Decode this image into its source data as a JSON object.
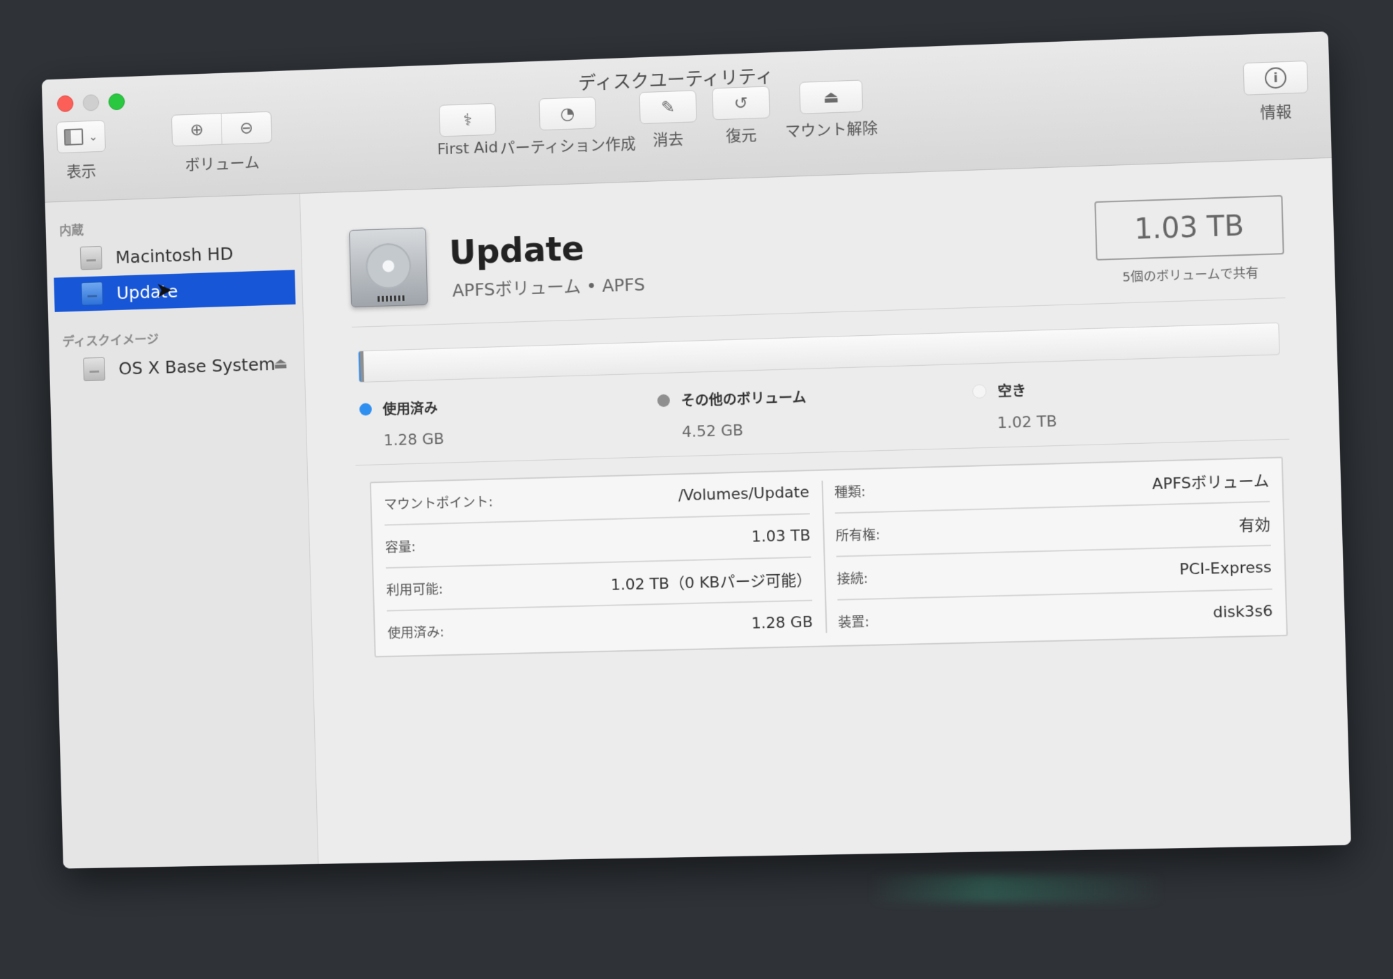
{
  "window": {
    "title": "ディスクユーティリティ"
  },
  "toolbar": {
    "view_label": "表示",
    "volume_label": "ボリューム",
    "firstaid_label": "First Aid",
    "partition_label": "パーティション作成",
    "erase_label": "消去",
    "restore_label": "復元",
    "unmount_label": "マウント解除",
    "info_label": "情報"
  },
  "sidebar": {
    "internal_header": "内蔵",
    "internal_items": [
      {
        "label": "Macintosh HD"
      },
      {
        "label": "Update"
      }
    ],
    "images_header": "ディスクイメージ",
    "image_items": [
      {
        "label": "OS X Base System"
      }
    ]
  },
  "volume": {
    "name": "Update",
    "subtitle": "APFSボリューム • APFS",
    "capacity": "1.03 TB",
    "capacity_sub": "5個のボリュームで共有"
  },
  "usage": {
    "used_fraction": 0.0012,
    "other_fraction": 0.0044,
    "legend": [
      {
        "label": "使用済み",
        "value": "1.28 GB",
        "color": "#2f8ff0"
      },
      {
        "label": "その他のボリューム",
        "value": "4.52 GB",
        "color": "#8f8f8f"
      },
      {
        "label": "空き",
        "value": "1.02 TB",
        "color": "#f5f5f5"
      }
    ]
  },
  "info": {
    "left": [
      {
        "key": "マウントポイント:",
        "value": "/Volumes/Update"
      },
      {
        "key": "容量:",
        "value": "1.03 TB"
      },
      {
        "key": "利用可能:",
        "value": "1.02 TB（0 KBパージ可能）"
      },
      {
        "key": "使用済み:",
        "value": "1.28 GB"
      }
    ],
    "right": [
      {
        "key": "種類:",
        "value": "APFSボリューム"
      },
      {
        "key": "所有権:",
        "value": "有効"
      },
      {
        "key": "接続:",
        "value": "PCI-Express"
      },
      {
        "key": "装置:",
        "value": "disk3s6"
      }
    ]
  }
}
